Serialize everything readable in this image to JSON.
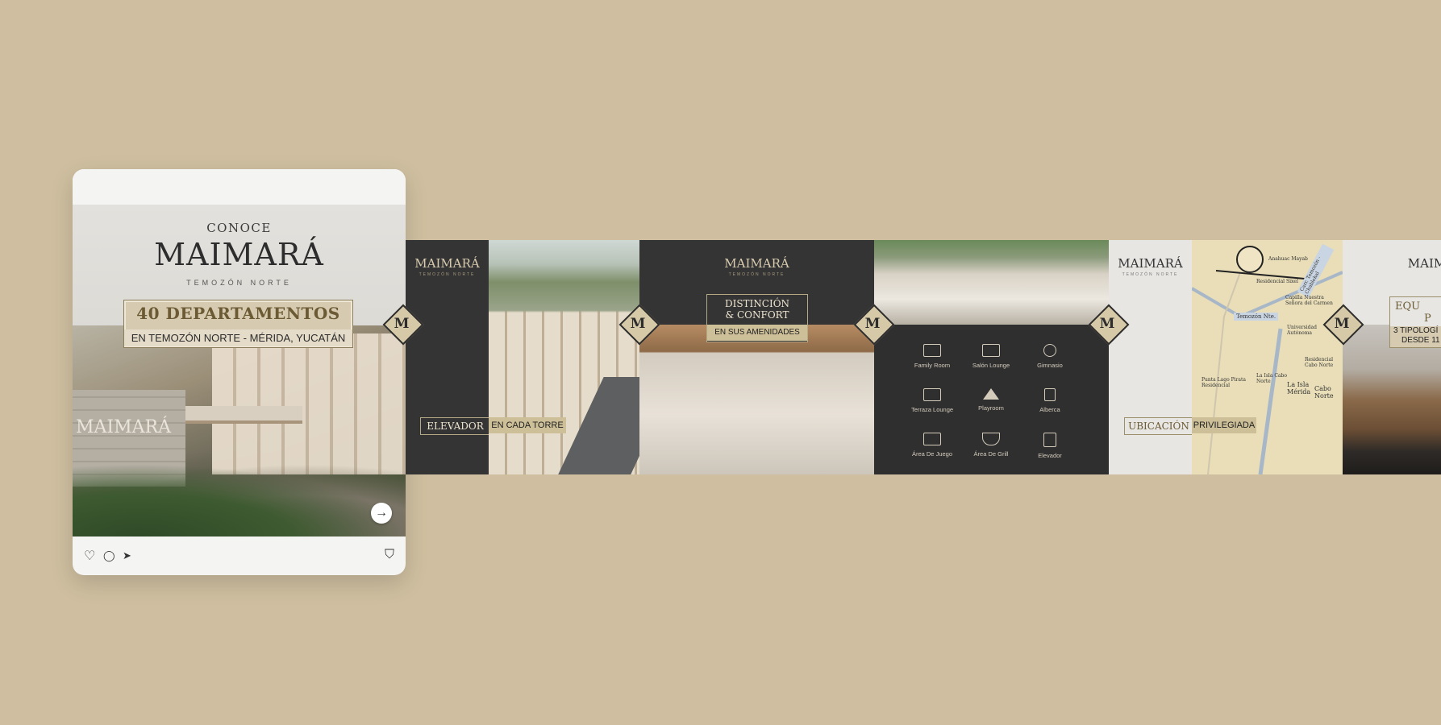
{
  "card": {
    "conoce": "CONOCE",
    "logo": "MAIMARÁ",
    "logo_sub": "TEMOZÓN NORTE",
    "badge_title": "40 DEPARTAMENTOS",
    "badge_sub": "EN TEMOZÓN NORTE - MÉRIDA, YUCATÁN",
    "wall_text": "MAIMARÁ",
    "next_arrow": "→",
    "actions": {
      "like": "♡",
      "comment": "◯",
      "share": "➤",
      "save": "⛉"
    }
  },
  "strip": {
    "logo": "MAIMARÁ",
    "logo_sub": "TEMOZÓN NORTE",
    "diamond_letter": "M",
    "panel1": {
      "label_left": "ELEVADOR",
      "label_right": "EN CADA TORRE"
    },
    "panel2": {
      "title_line1": "DISTINCIÓN",
      "title_line2": "& CONFORT",
      "subtitle": "EN SUS AMENIDADES"
    },
    "amenities": [
      {
        "label": "Family Room"
      },
      {
        "label": "Salón Lounge"
      },
      {
        "label": "Gimnasio"
      },
      {
        "label": "Terraza Lounge"
      },
      {
        "label": "Playroom"
      },
      {
        "label": "Alberca"
      },
      {
        "label": "Área De Juego"
      },
      {
        "label": "Área De Grill"
      },
      {
        "label": "Elevador"
      }
    ],
    "panel4": {
      "label_left": "UBICACIÓN",
      "label_right": "PRIVILEGIADA"
    },
    "map": {
      "roads": [
        "Temozón Nte.",
        "Carr. Temozón - Chablekal"
      ],
      "places": [
        "Anahuac Mayab",
        "Residencial Sixel",
        "Capilla Nuestra Señora del Carmen",
        "Universidad Autónoma",
        "Residencial Cabo Norte",
        "La Isla Cabo Norte",
        "Punta Lago Pirata Residencial",
        "La Isla Mérida",
        "Cabo Norte"
      ]
    },
    "panel6": {
      "title_line1": "EQU",
      "title_line2": "P",
      "sub_line1": "3 TIPOLOGÍ",
      "sub_line2": "DESDE 11"
    }
  }
}
